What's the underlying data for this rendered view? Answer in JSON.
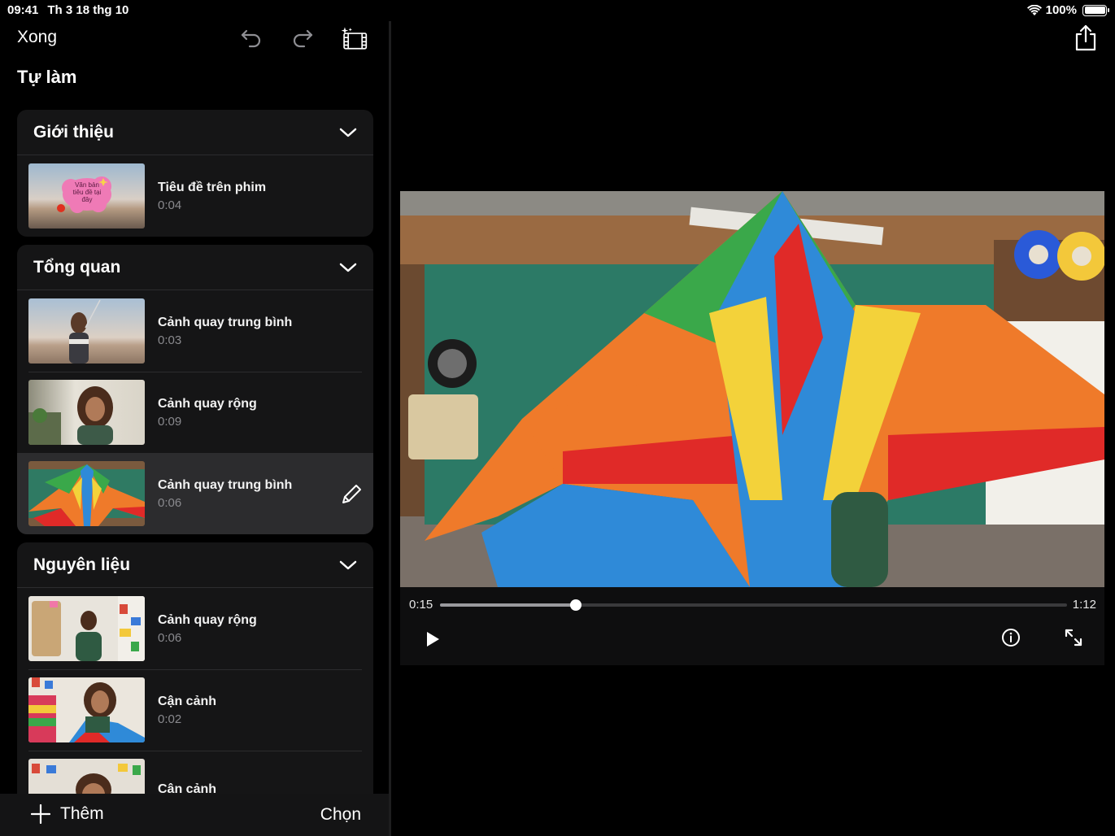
{
  "status_bar": {
    "time": "09:41",
    "date": "Th 3 18 thg 10",
    "battery": "100%"
  },
  "toolbar": {
    "done_label": "Xong"
  },
  "page_title": "Tự làm",
  "sections": [
    {
      "title": "Giới thiệu",
      "clips": [
        {
          "title": "Tiêu đề trên phim",
          "duration": "0:04",
          "overlay": "Văn bản tiêu đề tại đây"
        }
      ]
    },
    {
      "title": "Tổng quan",
      "clips": [
        {
          "title": "Cảnh quay trung bình",
          "duration": "0:03"
        },
        {
          "title": "Cảnh quay rộng",
          "duration": "0:09"
        },
        {
          "title": "Cảnh quay trung bình",
          "duration": "0:06",
          "selected": true
        }
      ]
    },
    {
      "title": "Nguyên liệu",
      "clips": [
        {
          "title": "Cảnh quay rộng",
          "duration": "0:06"
        },
        {
          "title": "Cận cảnh",
          "duration": "0:02"
        },
        {
          "title": "Cận cảnh",
          "duration": ""
        }
      ]
    }
  ],
  "bottom_bar": {
    "add_label": "Thêm",
    "select_label": "Chọn"
  },
  "player": {
    "current_time": "0:15",
    "total_time": "1:12",
    "progress": 0.216
  },
  "icons": [
    "undo-icon",
    "redo-icon",
    "magic-movie-icon",
    "chevron-down-icon",
    "pencil-icon",
    "plus-icon",
    "share-icon",
    "play-icon",
    "info-icon",
    "fullscreen-icon",
    "wifi-icon",
    "battery-icon"
  ]
}
